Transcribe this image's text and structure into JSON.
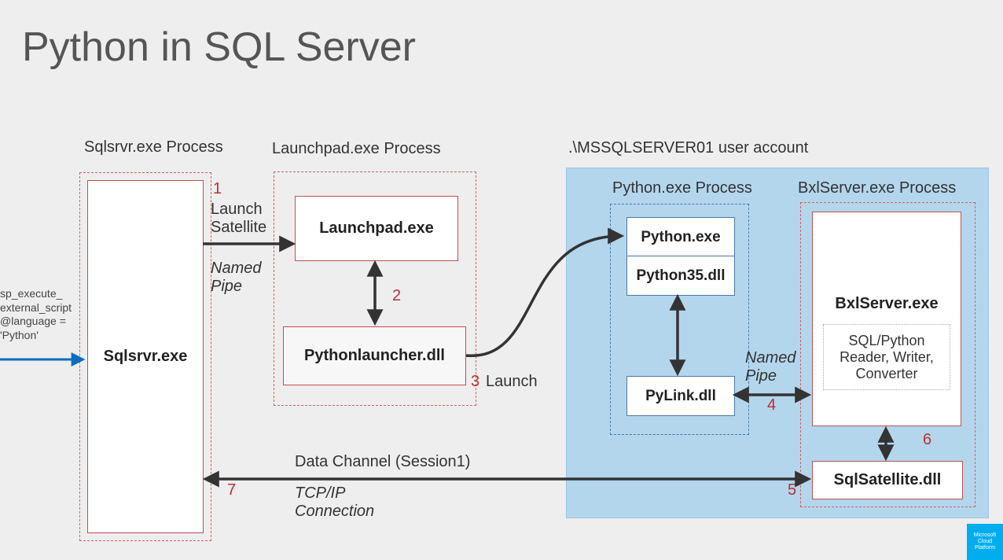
{
  "title": "Python in SQL Server",
  "processes": {
    "sqlsrvr_title": "Sqlsrvr.exe Process",
    "launchpad_title": "Launchpad.exe  Process",
    "user_account_title": ".\\MSSQLSERVER01 user account",
    "python_title": "Python.exe Process",
    "bxl_title": "BxlServer.exe Process"
  },
  "boxes": {
    "sqlsrvr": "Sqlsrvr.exe",
    "launchpad": "Launchpad.exe",
    "pylauncher": "Pythonlauncher.dll",
    "python_exe": "Python.exe",
    "python35": "Python35.dll",
    "pylink": "PyLink.dll",
    "bxlserver": "BxlServer.exe",
    "readerwriter": "SQL/Python Reader, Writer, Converter",
    "sqlsatellite": "SqlSatellite.dll"
  },
  "annotations": {
    "launch_satellite_1": "Launch",
    "launch_satellite_2": "Satellite",
    "named_pipe_1": "Named",
    "named_pipe_2": "Pipe",
    "launch3": "Launch",
    "named_pipe2_1": "Named",
    "named_pipe2_2": "Pipe",
    "data_channel": "Data Channel (Session1)",
    "tcpip_1": "TCP/IP",
    "tcpip_2": "Connection"
  },
  "steps": {
    "s1": "1",
    "s2": "2",
    "s3": "3",
    "s4": "4",
    "s5": "5",
    "s6": "6",
    "s7": "7"
  },
  "script": {
    "l1": "sp_execute_",
    "l2": "external_script",
    "l3": "@language =",
    "l4": "'Python'"
  },
  "logo": "Microsoft Cloud Platform"
}
